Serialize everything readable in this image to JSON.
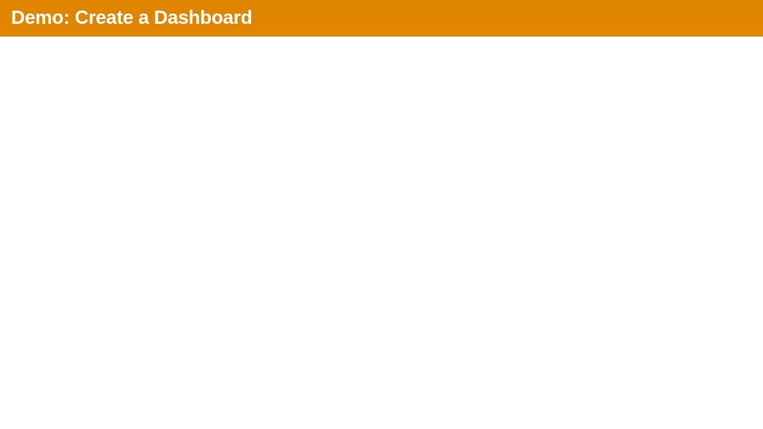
{
  "header": {
    "title": "Demo: Create a Dashboard",
    "background_color": "#e08500",
    "text_color": "#ffffff"
  }
}
